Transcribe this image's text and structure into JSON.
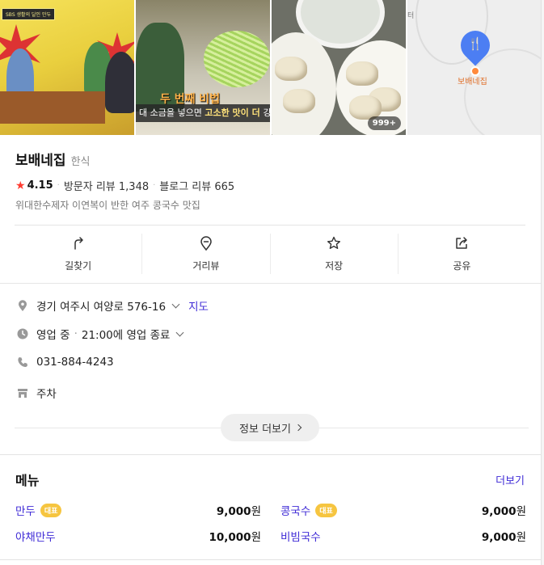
{
  "photos": {
    "tv_tag": "SBS 생활의 달인 만두",
    "subtitle_parts": [
      "대 소금을 넣으면 ",
      "고소한 맛이 더 ",
      "강"
    ],
    "orange_caption": "두 번째 비법",
    "photo_count": "999+",
    "map": {
      "pin_label": "보배네집",
      "edge_text": "터"
    }
  },
  "place": {
    "name": "보배네집",
    "category": "한식",
    "rating": "4.15",
    "visitor_reviews": "방문자 리뷰 1,348",
    "blog_reviews": "블로그 리뷰 665",
    "description": "위대한수제자 이연복이 반한 여주 콩국수 맛집"
  },
  "actions": [
    {
      "label": "길찾기",
      "icon": "directions-icon"
    },
    {
      "label": "거리뷰",
      "icon": "street-view-icon"
    },
    {
      "label": "저장",
      "icon": "star-icon"
    },
    {
      "label": "공유",
      "icon": "share-icon"
    }
  ],
  "info": {
    "address": "경기 여주시 여양로 576-16",
    "map_link": "지도",
    "status": "영업 중",
    "hours": "21:00에 영업 종료",
    "phone": "031-884-4243",
    "parking": "주차",
    "more_button": "정보 더보기"
  },
  "menu": {
    "title": "메뉴",
    "more": "더보기",
    "items": [
      {
        "name": "만두",
        "badge": "대표",
        "price": "9,000",
        "unit": "원"
      },
      {
        "name": "콩국수",
        "badge": "대표",
        "price": "9,000",
        "unit": "원"
      },
      {
        "name": "야채만두",
        "badge": "",
        "price": "10,000",
        "unit": "원"
      },
      {
        "name": "비빔국수",
        "badge": "",
        "price": "9,000",
        "unit": "원"
      }
    ]
  },
  "colors": {
    "accent_link": "#3f2bd6",
    "star": "#ff3b30",
    "badge": "#f6c540",
    "map_pin": "#4c7ef3"
  }
}
